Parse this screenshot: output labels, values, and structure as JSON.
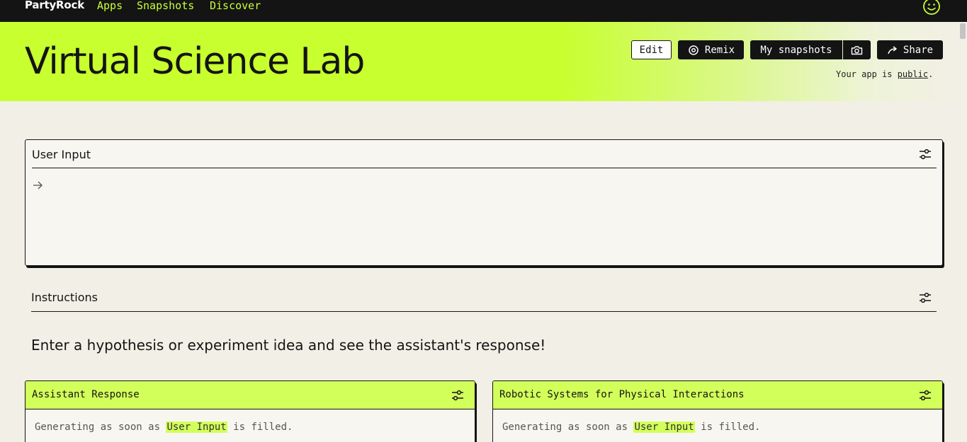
{
  "nav": {
    "brand": "PartyRock",
    "links": [
      "Apps",
      "Snapshots",
      "Discover"
    ]
  },
  "header": {
    "title": "Virtual Science Lab",
    "buttons": {
      "edit": "Edit",
      "remix": "Remix",
      "snapshots": "My snapshots",
      "share": "Share"
    },
    "public_prefix": "Your app is ",
    "public_link": "public",
    "public_suffix": "."
  },
  "user_input": {
    "title": "User Input"
  },
  "instructions": {
    "title": "Instructions",
    "text": "Enter a hypothesis or experiment idea and see the assistant's response!"
  },
  "widgets": [
    {
      "title": "Assistant Response",
      "status_prefix": "Generating as soon as ",
      "status_ref": "User Input",
      "status_suffix": " is filled."
    },
    {
      "title": "Robotic Systems for Physical Interactions",
      "status_prefix": "Generating as soon as ",
      "status_ref": "User Input",
      "status_suffix": " is filled."
    }
  ],
  "colors": {
    "accent": "#c8ff2e",
    "dark": "#141414",
    "background": "#f2efe6"
  }
}
